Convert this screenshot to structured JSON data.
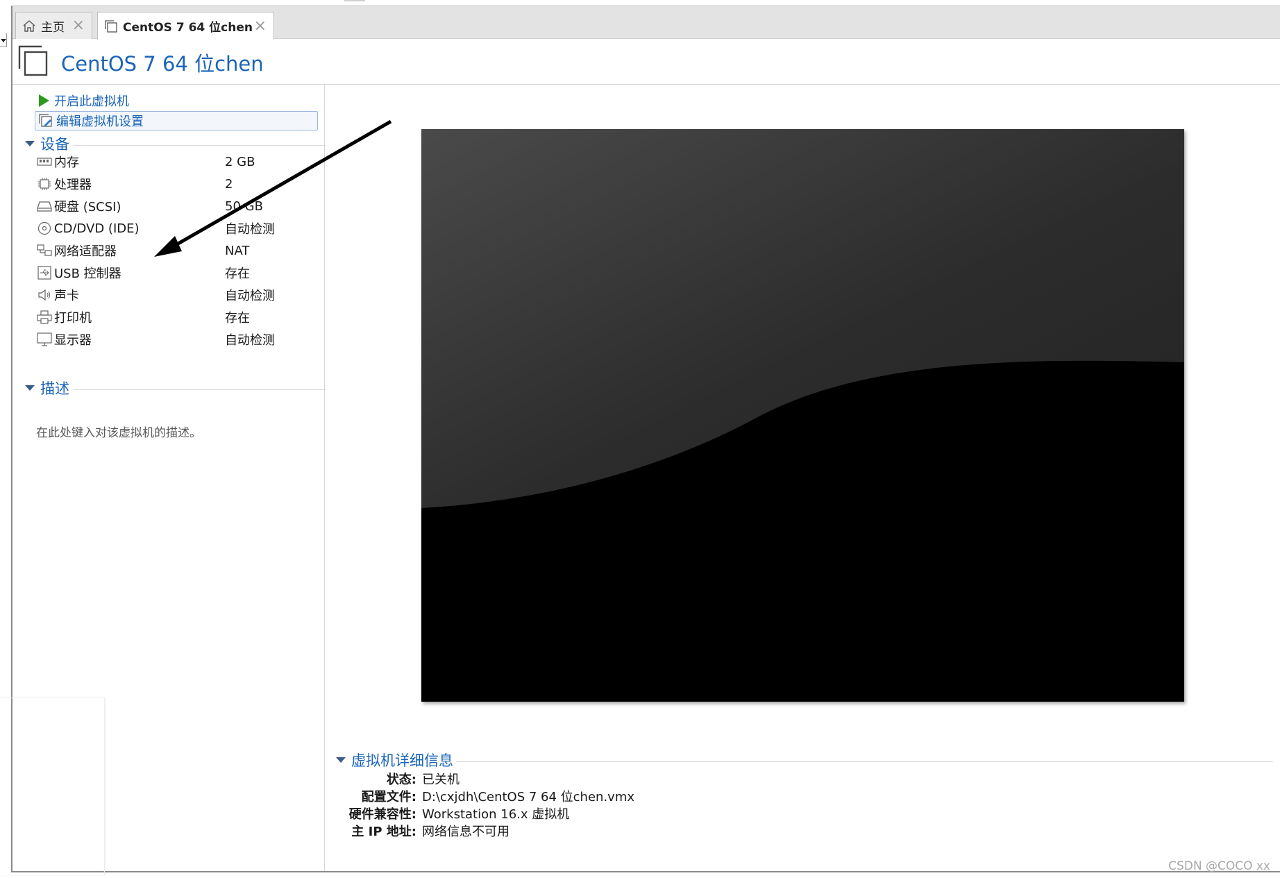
{
  "tabs": [
    {
      "label": "主页",
      "icon": "home-icon"
    },
    {
      "label": "CentOS 7 64 位chen",
      "icon": "vm-icon"
    }
  ],
  "vm": {
    "title": "CentOS 7 64 位chen"
  },
  "commands": {
    "power_on": "开启此虚拟机",
    "edit_settings": "编辑虚拟机设置"
  },
  "devices": {
    "section_label": "设备",
    "items": [
      {
        "name": "内存",
        "value": "2 GB",
        "icon": "memory-icon"
      },
      {
        "name": "处理器",
        "value": "2",
        "icon": "processor-icon"
      },
      {
        "name": "硬盘 (SCSI)",
        "value": "50 GB",
        "icon": "hard-disk-icon"
      },
      {
        "name": "CD/DVD (IDE)",
        "value": "自动检测",
        "icon": "cd-dvd-icon"
      },
      {
        "name": "网络适配器",
        "value": "NAT",
        "icon": "network-adapter-icon"
      },
      {
        "name": "USB 控制器",
        "value": "存在",
        "icon": "usb-controller-icon"
      },
      {
        "name": "声卡",
        "value": "自动检测",
        "icon": "sound-card-icon"
      },
      {
        "name": "打印机",
        "value": "存在",
        "icon": "printer-icon"
      },
      {
        "name": "显示器",
        "value": "自动检测",
        "icon": "display-icon"
      }
    ]
  },
  "description": {
    "section_label": "描述",
    "placeholder": "在此处键入对该虚拟机的描述。"
  },
  "details": {
    "section_label": "虚拟机详细信息",
    "rows": [
      {
        "key": "状态:",
        "value": "已关机"
      },
      {
        "key": "配置文件:",
        "value": "D:\\cxjdh\\CentOS 7 64 位chen.vmx"
      },
      {
        "key": "硬件兼容性:",
        "value": "Workstation 16.x 虚拟机"
      },
      {
        "key": "主 IP 地址:",
        "value": "网络信息不可用"
      }
    ]
  },
  "watermark": "CSDN @COCO xx",
  "colors": {
    "accent": "#1a64b9",
    "play_green": "#2a9a1a",
    "tabbar": "#e3e3e3"
  }
}
